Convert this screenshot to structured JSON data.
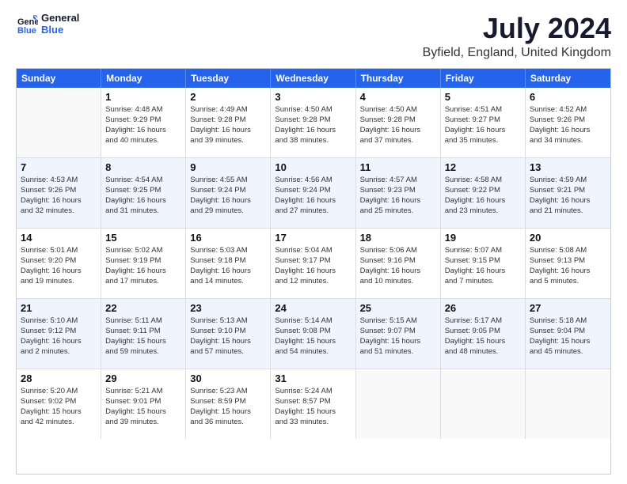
{
  "logo": {
    "line1": "General",
    "line2": "Blue"
  },
  "title": "July 2024",
  "subtitle": "Byfield, England, United Kingdom",
  "days": [
    "Sunday",
    "Monday",
    "Tuesday",
    "Wednesday",
    "Thursday",
    "Friday",
    "Saturday"
  ],
  "weeks": [
    [
      {
        "day": "",
        "lines": []
      },
      {
        "day": "1",
        "lines": [
          "Sunrise: 4:48 AM",
          "Sunset: 9:29 PM",
          "Daylight: 16 hours",
          "and 40 minutes."
        ]
      },
      {
        "day": "2",
        "lines": [
          "Sunrise: 4:49 AM",
          "Sunset: 9:28 PM",
          "Daylight: 16 hours",
          "and 39 minutes."
        ]
      },
      {
        "day": "3",
        "lines": [
          "Sunrise: 4:50 AM",
          "Sunset: 9:28 PM",
          "Daylight: 16 hours",
          "and 38 minutes."
        ]
      },
      {
        "day": "4",
        "lines": [
          "Sunrise: 4:50 AM",
          "Sunset: 9:28 PM",
          "Daylight: 16 hours",
          "and 37 minutes."
        ]
      },
      {
        "day": "5",
        "lines": [
          "Sunrise: 4:51 AM",
          "Sunset: 9:27 PM",
          "Daylight: 16 hours",
          "and 35 minutes."
        ]
      },
      {
        "day": "6",
        "lines": [
          "Sunrise: 4:52 AM",
          "Sunset: 9:26 PM",
          "Daylight: 16 hours",
          "and 34 minutes."
        ]
      }
    ],
    [
      {
        "day": "7",
        "lines": [
          "Sunrise: 4:53 AM",
          "Sunset: 9:26 PM",
          "Daylight: 16 hours",
          "and 32 minutes."
        ]
      },
      {
        "day": "8",
        "lines": [
          "Sunrise: 4:54 AM",
          "Sunset: 9:25 PM",
          "Daylight: 16 hours",
          "and 31 minutes."
        ]
      },
      {
        "day": "9",
        "lines": [
          "Sunrise: 4:55 AM",
          "Sunset: 9:24 PM",
          "Daylight: 16 hours",
          "and 29 minutes."
        ]
      },
      {
        "day": "10",
        "lines": [
          "Sunrise: 4:56 AM",
          "Sunset: 9:24 PM",
          "Daylight: 16 hours",
          "and 27 minutes."
        ]
      },
      {
        "day": "11",
        "lines": [
          "Sunrise: 4:57 AM",
          "Sunset: 9:23 PM",
          "Daylight: 16 hours",
          "and 25 minutes."
        ]
      },
      {
        "day": "12",
        "lines": [
          "Sunrise: 4:58 AM",
          "Sunset: 9:22 PM",
          "Daylight: 16 hours",
          "and 23 minutes."
        ]
      },
      {
        "day": "13",
        "lines": [
          "Sunrise: 4:59 AM",
          "Sunset: 9:21 PM",
          "Daylight: 16 hours",
          "and 21 minutes."
        ]
      }
    ],
    [
      {
        "day": "14",
        "lines": [
          "Sunrise: 5:01 AM",
          "Sunset: 9:20 PM",
          "Daylight: 16 hours",
          "and 19 minutes."
        ]
      },
      {
        "day": "15",
        "lines": [
          "Sunrise: 5:02 AM",
          "Sunset: 9:19 PM",
          "Daylight: 16 hours",
          "and 17 minutes."
        ]
      },
      {
        "day": "16",
        "lines": [
          "Sunrise: 5:03 AM",
          "Sunset: 9:18 PM",
          "Daylight: 16 hours",
          "and 14 minutes."
        ]
      },
      {
        "day": "17",
        "lines": [
          "Sunrise: 5:04 AM",
          "Sunset: 9:17 PM",
          "Daylight: 16 hours",
          "and 12 minutes."
        ]
      },
      {
        "day": "18",
        "lines": [
          "Sunrise: 5:06 AM",
          "Sunset: 9:16 PM",
          "Daylight: 16 hours",
          "and 10 minutes."
        ]
      },
      {
        "day": "19",
        "lines": [
          "Sunrise: 5:07 AM",
          "Sunset: 9:15 PM",
          "Daylight: 16 hours",
          "and 7 minutes."
        ]
      },
      {
        "day": "20",
        "lines": [
          "Sunrise: 5:08 AM",
          "Sunset: 9:13 PM",
          "Daylight: 16 hours",
          "and 5 minutes."
        ]
      }
    ],
    [
      {
        "day": "21",
        "lines": [
          "Sunrise: 5:10 AM",
          "Sunset: 9:12 PM",
          "Daylight: 16 hours",
          "and 2 minutes."
        ]
      },
      {
        "day": "22",
        "lines": [
          "Sunrise: 5:11 AM",
          "Sunset: 9:11 PM",
          "Daylight: 15 hours",
          "and 59 minutes."
        ]
      },
      {
        "day": "23",
        "lines": [
          "Sunrise: 5:13 AM",
          "Sunset: 9:10 PM",
          "Daylight: 15 hours",
          "and 57 minutes."
        ]
      },
      {
        "day": "24",
        "lines": [
          "Sunrise: 5:14 AM",
          "Sunset: 9:08 PM",
          "Daylight: 15 hours",
          "and 54 minutes."
        ]
      },
      {
        "day": "25",
        "lines": [
          "Sunrise: 5:15 AM",
          "Sunset: 9:07 PM",
          "Daylight: 15 hours",
          "and 51 minutes."
        ]
      },
      {
        "day": "26",
        "lines": [
          "Sunrise: 5:17 AM",
          "Sunset: 9:05 PM",
          "Daylight: 15 hours",
          "and 48 minutes."
        ]
      },
      {
        "day": "27",
        "lines": [
          "Sunrise: 5:18 AM",
          "Sunset: 9:04 PM",
          "Daylight: 15 hours",
          "and 45 minutes."
        ]
      }
    ],
    [
      {
        "day": "28",
        "lines": [
          "Sunrise: 5:20 AM",
          "Sunset: 9:02 PM",
          "Daylight: 15 hours",
          "and 42 minutes."
        ]
      },
      {
        "day": "29",
        "lines": [
          "Sunrise: 5:21 AM",
          "Sunset: 9:01 PM",
          "Daylight: 15 hours",
          "and 39 minutes."
        ]
      },
      {
        "day": "30",
        "lines": [
          "Sunrise: 5:23 AM",
          "Sunset: 8:59 PM",
          "Daylight: 15 hours",
          "and 36 minutes."
        ]
      },
      {
        "day": "31",
        "lines": [
          "Sunrise: 5:24 AM",
          "Sunset: 8:57 PM",
          "Daylight: 15 hours",
          "and 33 minutes."
        ]
      },
      {
        "day": "",
        "lines": []
      },
      {
        "day": "",
        "lines": []
      },
      {
        "day": "",
        "lines": []
      }
    ]
  ]
}
